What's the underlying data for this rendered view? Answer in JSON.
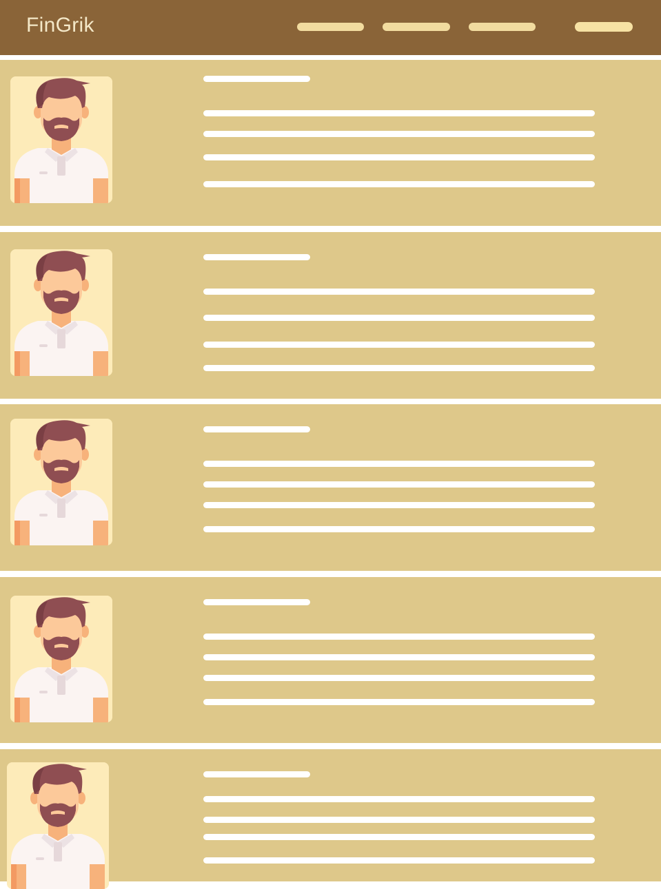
{
  "app": {
    "brand": "FinGrik"
  },
  "nav": {
    "items": [
      "",
      "",
      ""
    ],
    "action": ""
  },
  "colors": {
    "header_bg": "#8a6438",
    "card_bg": "#dec88a",
    "avatar_bg": "#fdebb9",
    "placeholder_line": "#ffffff",
    "nav_pill": "#f2dc9f"
  },
  "profiles": [
    {
      "avatar_icon": "bearded-man-avatar-icon",
      "name": "",
      "details": [
        "",
        "",
        "",
        ""
      ]
    },
    {
      "avatar_icon": "bearded-man-avatar-icon",
      "name": "",
      "details": [
        "",
        "",
        "",
        ""
      ]
    },
    {
      "avatar_icon": "bearded-man-avatar-icon",
      "name": "",
      "details": [
        "",
        "",
        "",
        ""
      ]
    },
    {
      "avatar_icon": "bearded-man-avatar-icon",
      "name": "",
      "details": [
        "",
        "",
        "",
        ""
      ]
    },
    {
      "avatar_icon": "bearded-man-avatar-icon",
      "name": "",
      "details": [
        "",
        "",
        "",
        ""
      ]
    }
  ]
}
